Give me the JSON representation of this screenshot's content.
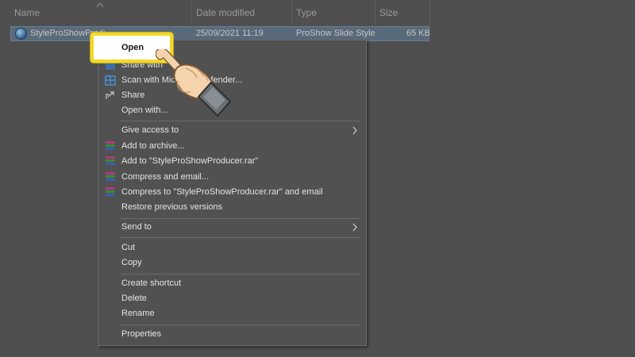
{
  "header": {
    "columns": [
      {
        "id": "name",
        "label": "Name"
      },
      {
        "id": "date",
        "label": "Date modified"
      },
      {
        "id": "type",
        "label": "Type"
      },
      {
        "id": "size",
        "label": "Size"
      }
    ]
  },
  "file": {
    "name": "StyleProShowProducer",
    "date_modified": "25/09/2021 11:19",
    "type": "ProShow Slide Style",
    "size": "65 KB"
  },
  "menu": {
    "open": "Open",
    "share_with": "Share with",
    "scan": "Scan with Microsoft Defender...",
    "share": "Share",
    "open_with": "Open with...",
    "give_access": "Give access to",
    "add_to_archive": "Add to archive...",
    "add_to_rar": "Add to \"StyleProShowProducer.rar\"",
    "compress_email": "Compress and email...",
    "compress_rar_email": "Compress to \"StyleProShowProducer.rar\" and email",
    "restore": "Restore previous versions",
    "send_to": "Send to",
    "cut": "Cut",
    "copy": "Copy",
    "create_shortcut": "Create shortcut",
    "delete": "Delete",
    "rename": "Rename",
    "properties": "Properties"
  },
  "colors": {
    "highlight_border": "#f2d82a",
    "selection": "#596a7a",
    "menu_bg": "#515151"
  }
}
